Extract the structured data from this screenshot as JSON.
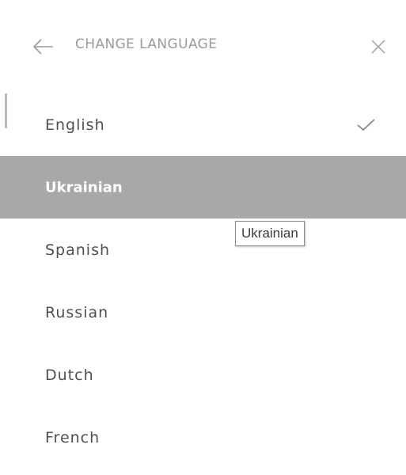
{
  "header": {
    "title": "CHANGE LANGUAGE",
    "back_icon": "arrow-left-icon",
    "close_icon": "close-icon"
  },
  "languages": [
    {
      "label": "English",
      "checked": true
    },
    {
      "label": "Ukrainian",
      "selected": true
    },
    {
      "label": "Spanish"
    },
    {
      "label": "Russian"
    },
    {
      "label": "Dutch"
    },
    {
      "label": "French"
    }
  ],
  "tooltip": {
    "text": "Ukrainian"
  },
  "colors": {
    "selected_background": "#a8a8a8",
    "text": "#4f4f4f",
    "title": "#9a9a9a"
  }
}
